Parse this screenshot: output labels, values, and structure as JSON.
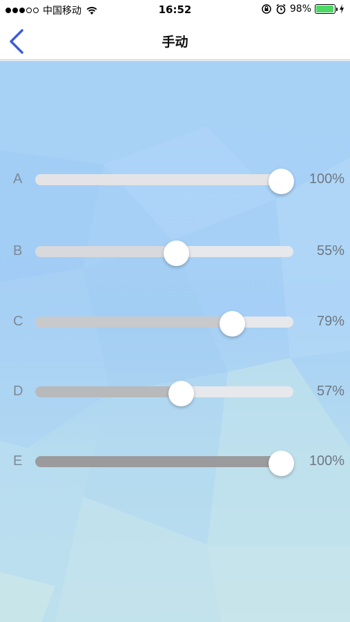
{
  "status_bar": {
    "carrier": "中国移动",
    "time": "16:52",
    "battery_percent": "98%",
    "battery_level": 0.98,
    "signal_bars_filled": 3,
    "signal_bars_total": 5,
    "icons": [
      "wifi-icon",
      "rotation-lock-icon",
      "alarm-icon",
      "battery-icon",
      "charging-icon"
    ]
  },
  "nav": {
    "title": "手动",
    "back_icon": "chevron-left-icon",
    "accent_color": "#3d5bd9"
  },
  "sliders": [
    {
      "label": "A",
      "value": 100,
      "value_text": "100%",
      "fill_color": "#e4e4e6"
    },
    {
      "label": "B",
      "value": 55,
      "value_text": "55%",
      "fill_color": "#d7d9dc"
    },
    {
      "label": "C",
      "value": 79,
      "value_text": "79%",
      "fill_color": "#c8c9cb"
    },
    {
      "label": "D",
      "value": 57,
      "value_text": "57%",
      "fill_color": "#b8b9bb"
    },
    {
      "label": "E",
      "value": 100,
      "value_text": "100%",
      "fill_color": "#9b9b9d"
    }
  ]
}
